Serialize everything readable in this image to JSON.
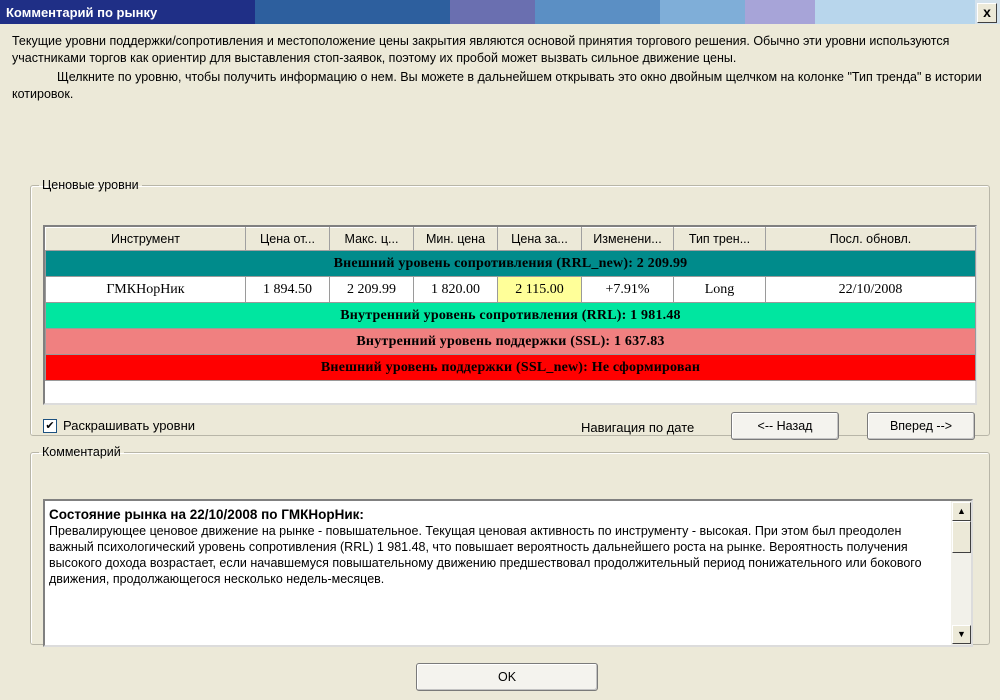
{
  "window": {
    "title": "Комментарий по рынку",
    "close_label": "x"
  },
  "intro": {
    "paragraph1": "Текущие уровни поддержки/сопротивления и местоположение цены закрытия являются основой принятия торгового решения. Обычно эти уровни используются участниками торгов как ориентир для выставления стоп-заявок, поэтому их пробой может вызвать сильное движение цены.",
    "paragraph2": "Щелкните по уровню, чтобы получить информацию о нем. Вы можете в дальнейшем открывать это окно двойным щелчком на колонке \"Тип тренда\" в истории котировок."
  },
  "levels": {
    "legend": "Ценовые уровни",
    "columns": [
      "Инструмент",
      "Цена от...",
      "Макс. ц...",
      "Мин. цена",
      "Цена за...",
      "Изменени...",
      "Тип трен...",
      "Посл. обновл."
    ],
    "bands": {
      "external_resistance": "Внешний уровень сопротивления (RRL_new): 2 209.99",
      "internal_resistance": "Внутренний уровень сопротивления (RRL): 1 981.48",
      "internal_support": "Внутренний уровень поддержки (SSL): 1 637.83",
      "external_support": "Внешний уровень поддержки (SSL_new): Не сформирован"
    },
    "row": {
      "instrument": "ГМКНорНик",
      "open": "1 894.50",
      "high": "2 209.99",
      "low": "1 820.00",
      "close": "2 115.00",
      "change": "+7.91%",
      "trend": "Long",
      "updated": "22/10/2008"
    },
    "colors": {
      "external_resistance": "#008b8b",
      "internal_resistance": "#00e6a0",
      "internal_support": "#f08080",
      "external_support": "#ff0000",
      "close_highlight": "#ffff99"
    },
    "colorize_label": "Раскрашивать уровни",
    "colorize_checked": "✔",
    "nav_label": "Навигация по дате",
    "back_button": "<-- Назад",
    "forward_button": "Вперед -->"
  },
  "comment": {
    "legend": "Комментарий",
    "heading": "Состояние рынка на 22/10/2008 по ГМКНорНик:",
    "body": "Превалирующее ценовое движение на рынке - повышательное.  Текущая ценовая активность по инструменту - высокая. При этом был преодолен важный психологический уровень сопротивления (RRL) 1 981.48, что повышает вероятность дальнейшего роста на рынке. Вероятность получения высокого дохода возрастает, если начавшемуся повышательному движению предшествовал продолжительный период понижательного или бокового движения, продолжающегося несколько недель-месяцев."
  },
  "ok_button": "OK"
}
